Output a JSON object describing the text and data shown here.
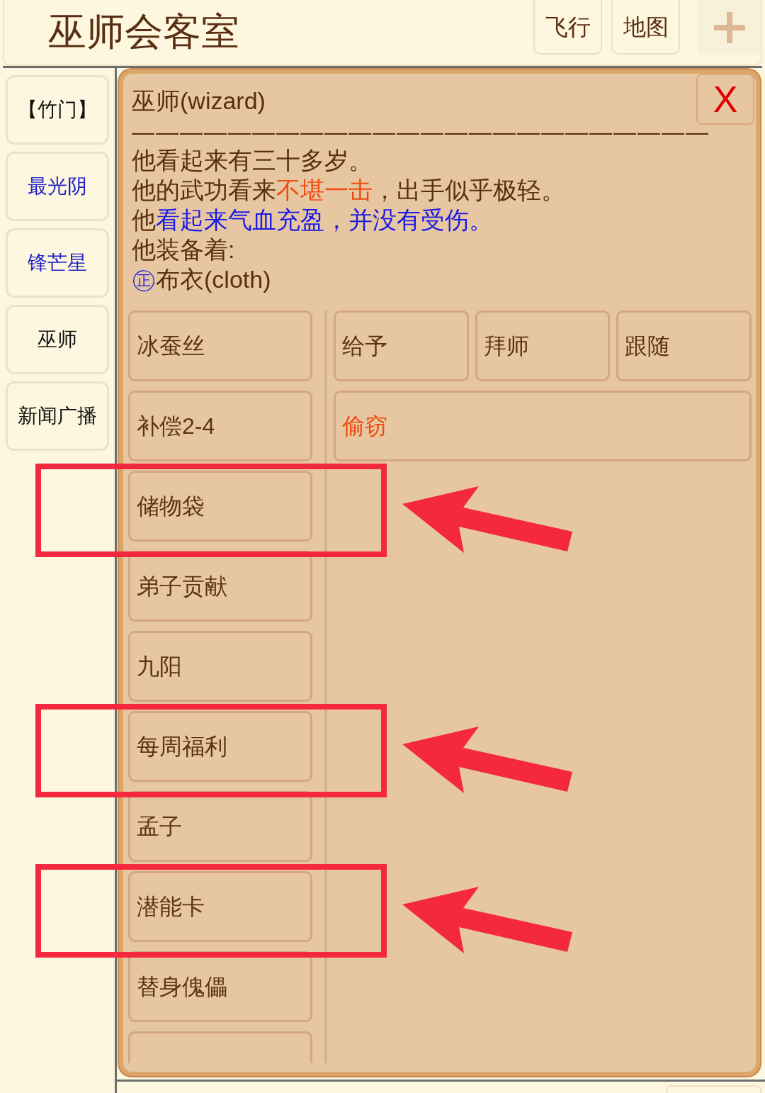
{
  "header": {
    "title": "巫师会客室",
    "buttons": [
      "飞行",
      "地图"
    ]
  },
  "sidebar": {
    "items": [
      {
        "label": "【竹门】",
        "color": "#111111"
      },
      {
        "label": "最光阴",
        "color": "#2323c8"
      },
      {
        "label": "锋芒星",
        "color": "#2323c8"
      },
      {
        "label": "巫师",
        "color": "#111111"
      },
      {
        "label": "新闻广播",
        "color": "#111111"
      }
    ]
  },
  "dialog": {
    "title": "巫师(wizard)",
    "close_label": "X",
    "rule": "————————————————————————",
    "lines": [
      {
        "segments": [
          {
            "text": "他看起来有三十多岁。",
            "kind": "plain"
          }
        ]
      },
      {
        "segments": [
          {
            "text": "他的武功看来",
            "kind": "plain"
          },
          {
            "text": "不堪一击",
            "kind": "warning"
          },
          {
            "text": "，出手似乎极轻。",
            "kind": "plain"
          }
        ]
      },
      {
        "segments": [
          {
            "text": "他",
            "kind": "plain"
          },
          {
            "text": "看起来气血充盈，并没有受伤。",
            "kind": "status"
          }
        ]
      },
      {
        "segments": [
          {
            "text": "他装备着:",
            "kind": "plain"
          }
        ]
      },
      {
        "segments": [
          {
            "text": "㊣",
            "kind": "badge"
          },
          {
            "text": "布衣(cloth)",
            "kind": "plain"
          }
        ]
      }
    ],
    "actions_left": [
      {
        "label": "冰蚕丝",
        "marked": false
      },
      {
        "label": "补偿2-4",
        "marked": false
      },
      {
        "label": "储物袋",
        "marked": true
      },
      {
        "label": "弟子贡献",
        "marked": false
      },
      {
        "label": "九阳",
        "marked": false
      },
      {
        "label": "每周福利",
        "marked": true
      },
      {
        "label": "孟子",
        "marked": false
      },
      {
        "label": "潜能卡",
        "marked": true
      },
      {
        "label": "替身傀儡",
        "marked": false
      },
      {
        "marked": false
      }
    ],
    "actions_right": [
      {
        "label": "给予",
        "kind": "normal"
      },
      {
        "label": "拜师",
        "kind": "normal"
      },
      {
        "label": "跟随",
        "kind": "normal"
      },
      {
        "label": "偷窃",
        "kind": "danger"
      }
    ]
  }
}
